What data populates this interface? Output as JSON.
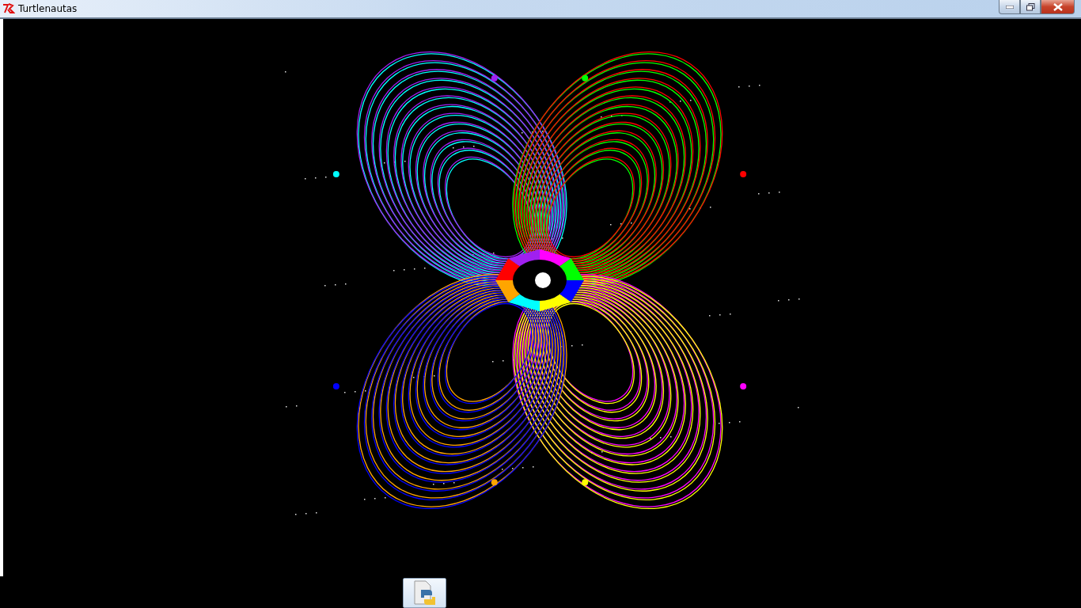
{
  "window": {
    "title": "Turtlenautas"
  }
}
